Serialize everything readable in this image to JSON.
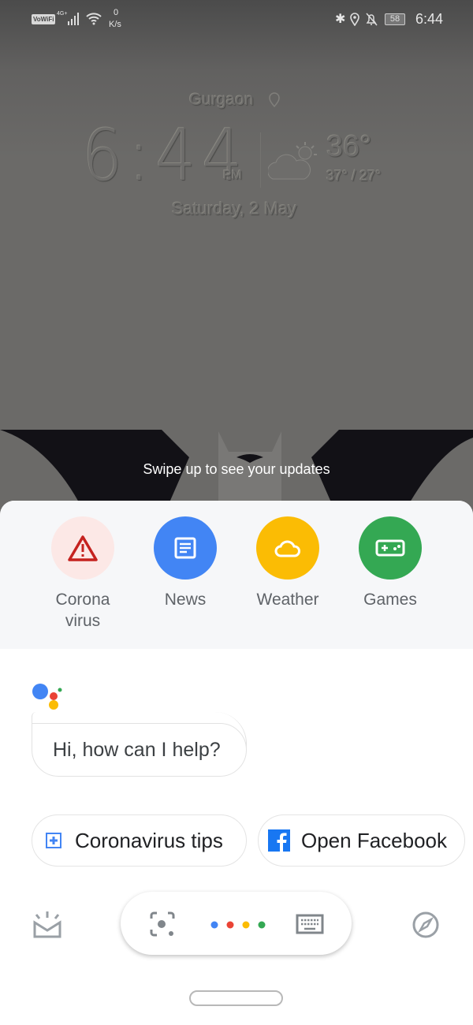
{
  "status_bar": {
    "wifi_calling": "VoWiFi",
    "network": "4G+",
    "speed_value": "0",
    "speed_unit": "K/s",
    "battery": "58",
    "time": "6:44"
  },
  "lockscreen": {
    "location": "Gurgaon",
    "time": "6:44",
    "ampm": "PM",
    "temperature": "36°",
    "temp_range": "37° / 27°",
    "date": "Saturday, 2 May",
    "weather_icon": "partly-cloudy-icon"
  },
  "swipe_hint": "Swipe up to see your updates",
  "topics": [
    {
      "label": "Corona\nvirus",
      "icon": "warning-icon",
      "color": "#fce8e6",
      "icon_color": "#c5221f"
    },
    {
      "label": "News",
      "icon": "article-icon",
      "color": "#4285f4"
    },
    {
      "label": "Weather",
      "icon": "cloud-icon",
      "color": "#fbbc04"
    },
    {
      "label": "Games",
      "icon": "gamepad-icon",
      "color": "#34a853"
    }
  ],
  "assistant": {
    "greeting": "Hi, how can I help?"
  },
  "suggestions": [
    {
      "label": "Coronavirus tips",
      "icon": "medical-plus-icon"
    },
    {
      "label": "Open Facebook",
      "icon": "facebook-icon"
    }
  ],
  "bottom_bar": {
    "left": "updates-inbox-icon",
    "lens": "lens-icon",
    "mic_dots": [
      "#4285f4",
      "#ea4335",
      "#fbbc04",
      "#34a853"
    ],
    "keyboard": "keyboard-icon",
    "right": "explore-compass-icon"
  }
}
